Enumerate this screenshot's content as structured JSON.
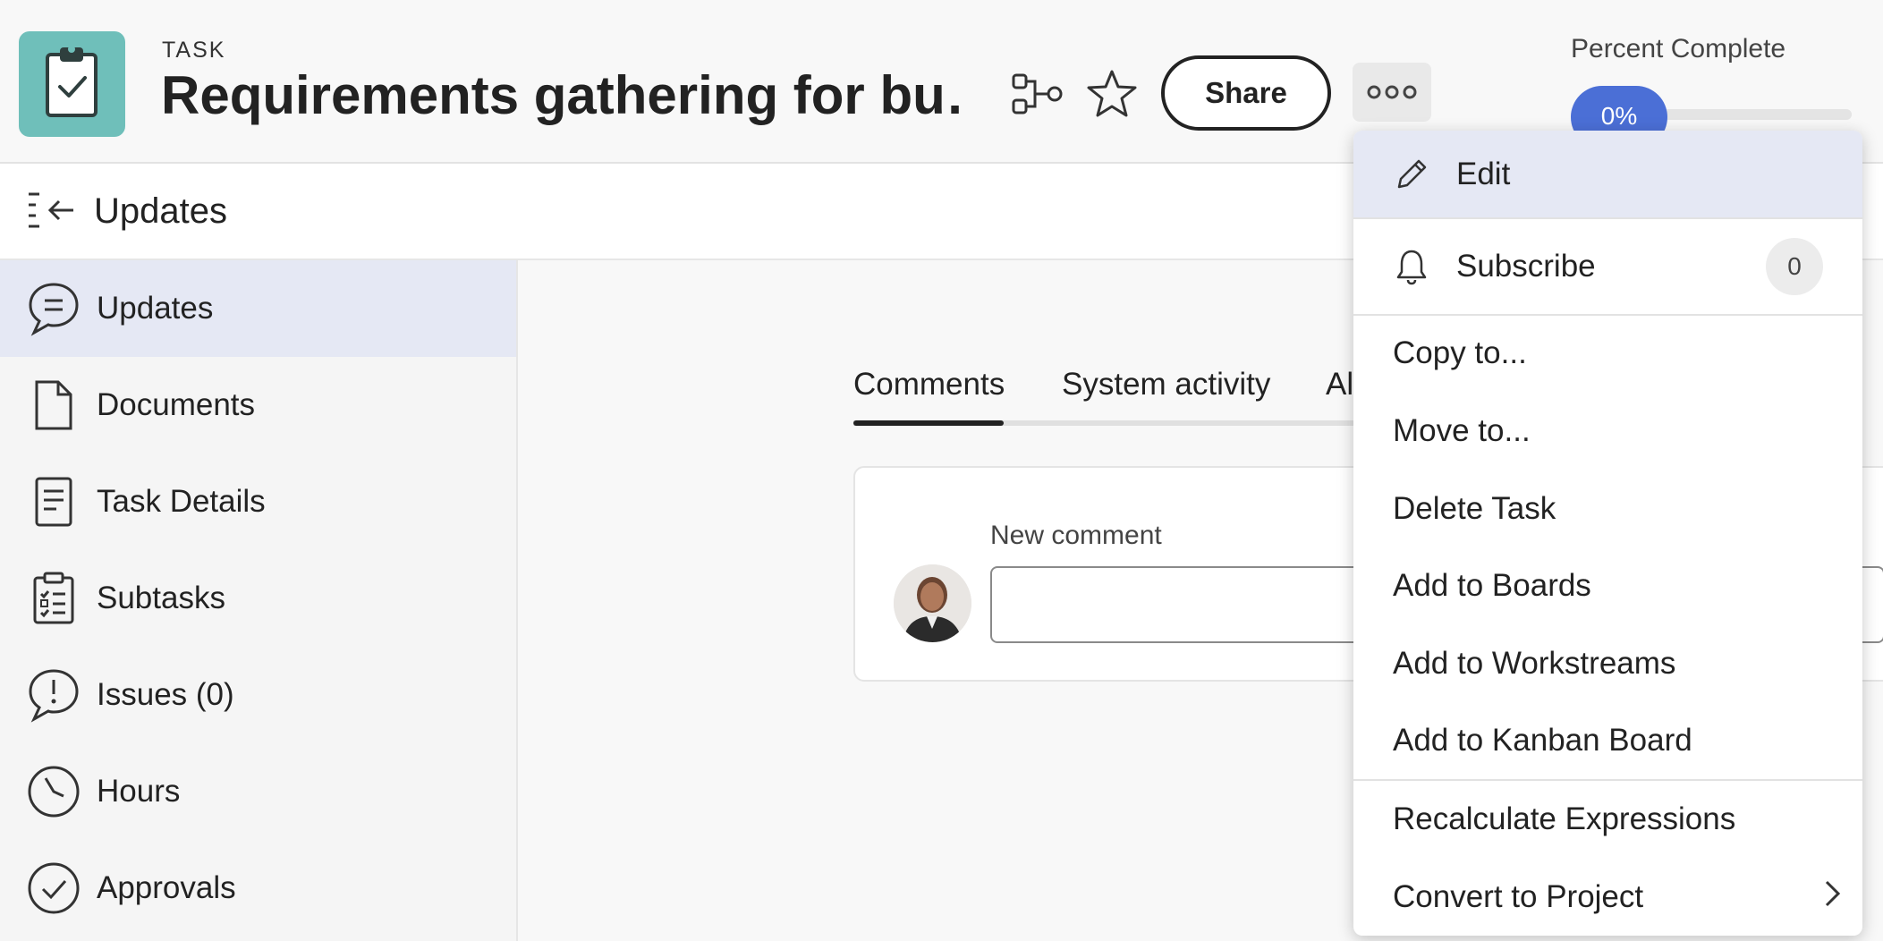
{
  "header": {
    "eyebrow": "TASK",
    "title": "Requirements gathering for bu…",
    "share_label": "Share",
    "percent_label": "Percent Complete",
    "percent_value": "0%",
    "percent_fraction": 0
  },
  "subheader": {
    "title": "Updates"
  },
  "sidebar": {
    "items": [
      {
        "label": "Updates",
        "icon": "chat-bubble-icon",
        "active": true
      },
      {
        "label": "Documents",
        "icon": "document-icon"
      },
      {
        "label": "Task Details",
        "icon": "task-details-icon"
      },
      {
        "label": "Subtasks",
        "icon": "clipboard-checklist-icon"
      },
      {
        "label": "Issues (0)",
        "icon": "issue-bubble-icon"
      },
      {
        "label": "Hours",
        "icon": "clock-icon"
      },
      {
        "label": "Approvals",
        "icon": "check-circle-icon"
      }
    ]
  },
  "main": {
    "tabs": [
      "Comments",
      "System activity",
      "Al"
    ],
    "new_comment_label": "New comment"
  },
  "menu": {
    "edit": "Edit",
    "subscribe": "Subscribe",
    "subscribe_count": "0",
    "copy_to": "Copy to...",
    "move_to": "Move to...",
    "delete_task": "Delete Task",
    "add_to_boards": "Add to Boards",
    "add_to_workstreams": "Add to Workstreams",
    "add_to_kanban": "Add to Kanban Board",
    "recalculate": "Recalculate Expressions",
    "convert": "Convert to Project"
  },
  "colors": {
    "accent": "#4b6fd6",
    "task_icon_bg": "#6fbfba",
    "active_nav_bg": "#e5e8f4"
  }
}
